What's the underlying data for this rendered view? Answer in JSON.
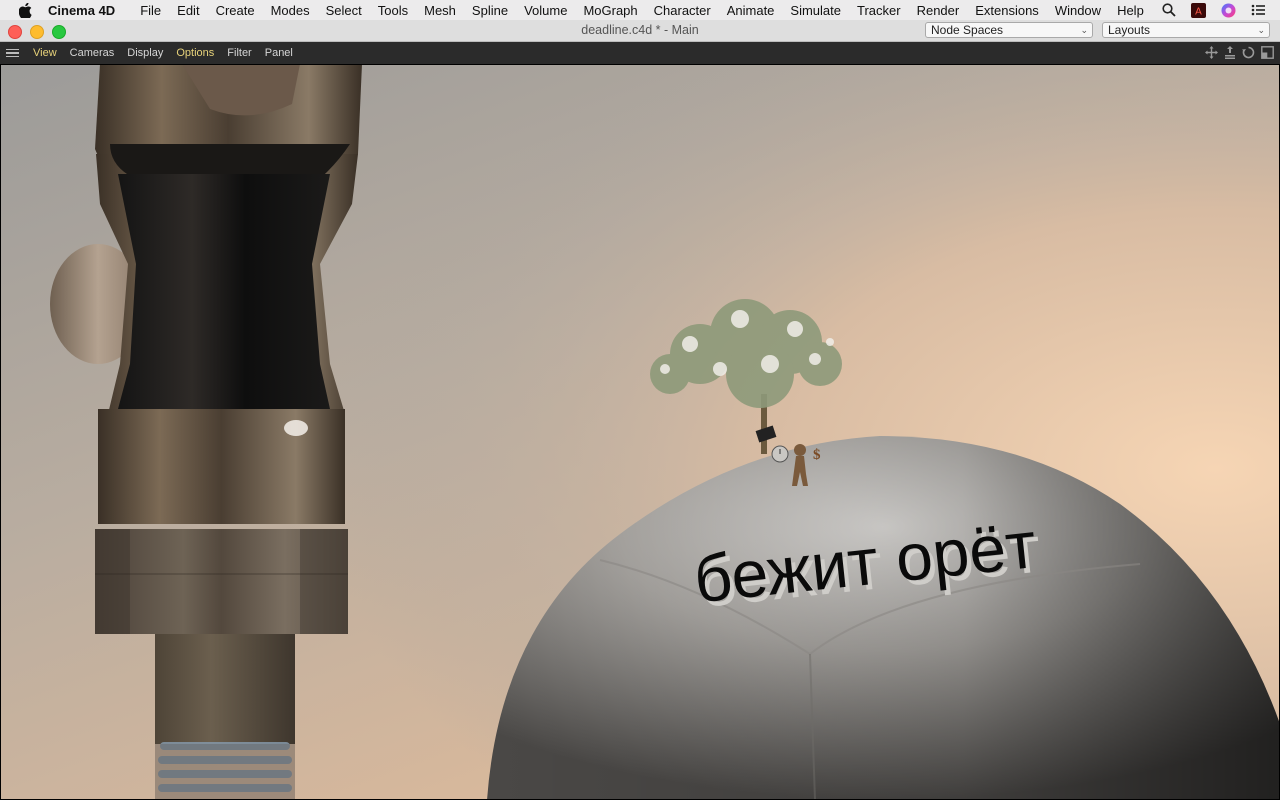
{
  "menubar": {
    "app_name": "Cinema 4D",
    "items": [
      "File",
      "Edit",
      "Create",
      "Modes",
      "Select",
      "Tools",
      "Mesh",
      "Spline",
      "Volume",
      "MoGraph",
      "Character",
      "Animate",
      "Simulate",
      "Tracker",
      "Render",
      "Extensions",
      "Window",
      "Help"
    ]
  },
  "window": {
    "title": "deadline.c4d * - Main",
    "node_spaces": "Node Spaces",
    "layouts": "Layouts"
  },
  "viewport_menu": {
    "items": [
      "View",
      "Cameras",
      "Display",
      "Options",
      "Filter",
      "Panel"
    ]
  },
  "scene": {
    "text_3d": "бежит орёт",
    "coin_symbol": "$"
  },
  "colors": {
    "active_menu": "#e7d27a",
    "close": "#fe5f57",
    "minimize": "#febc2e",
    "zoom": "#28c840"
  }
}
